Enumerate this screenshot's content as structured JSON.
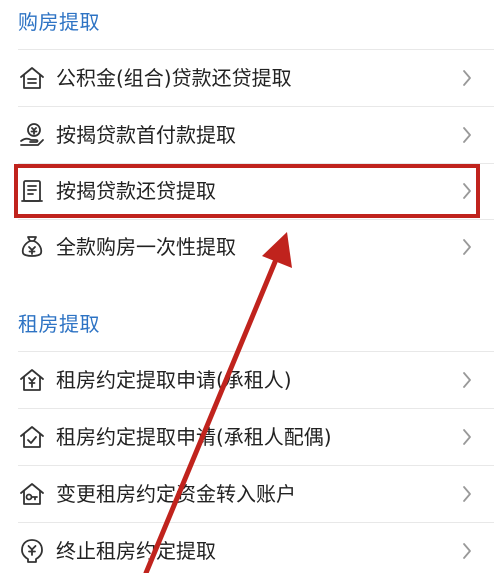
{
  "sections": [
    {
      "title": "购房提取",
      "items": [
        {
          "label": "公积金(组合)贷款还贷提取",
          "icon": "house-document-icon"
        },
        {
          "label": "按揭贷款首付款提取",
          "icon": "hand-coin-icon"
        },
        {
          "label": "按揭贷款还贷提取",
          "icon": "ledger-icon"
        },
        {
          "label": "全款购房一次性提取",
          "icon": "money-bag-icon"
        }
      ]
    },
    {
      "title": "租房提取",
      "items": [
        {
          "label": "租房约定提取申请(承租人)",
          "icon": "house-yen-icon"
        },
        {
          "label": "租房约定提取申请(承租人配偶)",
          "icon": "house-check-icon"
        },
        {
          "label": "变更租房约定资金转入账户",
          "icon": "house-key-icon"
        },
        {
          "label": "终止租房约定提取",
          "icon": "yen-badge-icon"
        }
      ]
    }
  ],
  "highlighted_item": "按揭贷款还贷提取",
  "colors": {
    "section_title": "#2d73c4",
    "highlight": "#c0231d",
    "icon_stroke": "#333333",
    "chevron": "#999999"
  }
}
